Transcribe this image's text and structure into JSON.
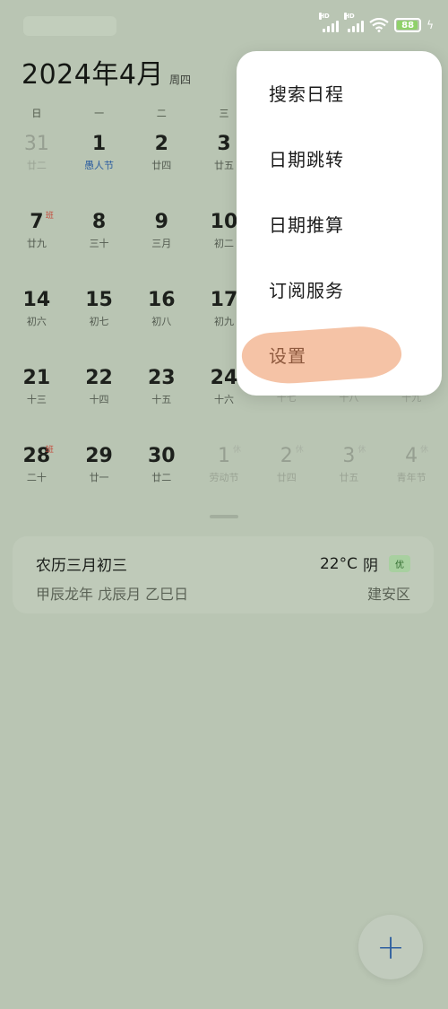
{
  "status": {
    "signal1_hd": "HD",
    "signal2_hd": "HD",
    "battery": "88"
  },
  "header": {
    "title": "2024年4月",
    "weekday": "周四"
  },
  "weekdays": [
    "日",
    "一",
    "二",
    "三",
    "四",
    "五",
    "六"
  ],
  "calendar": [
    {
      "day": "31",
      "lunar": "廿二",
      "faded": true
    },
    {
      "day": "1",
      "lunar": "愚人节",
      "festival": true
    },
    {
      "day": "2",
      "lunar": "廿四"
    },
    {
      "day": "3",
      "lunar": "廿五"
    },
    {
      "day": "",
      "lunar": ""
    },
    {
      "day": "",
      "lunar": ""
    },
    {
      "day": "",
      "lunar": ""
    },
    {
      "day": "7",
      "lunar": "廿九",
      "tag": "班"
    },
    {
      "day": "8",
      "lunar": "三十"
    },
    {
      "day": "9",
      "lunar": "三月"
    },
    {
      "day": "10",
      "lunar": "初二"
    },
    {
      "day": "",
      "lunar": ""
    },
    {
      "day": "",
      "lunar": ""
    },
    {
      "day": "",
      "lunar": ""
    },
    {
      "day": "14",
      "lunar": "初六"
    },
    {
      "day": "15",
      "lunar": "初七"
    },
    {
      "day": "16",
      "lunar": "初八"
    },
    {
      "day": "17",
      "lunar": "初九"
    },
    {
      "day": "",
      "lunar": ""
    },
    {
      "day": "",
      "lunar": ""
    },
    {
      "day": "",
      "lunar": ""
    },
    {
      "day": "21",
      "lunar": "十三"
    },
    {
      "day": "22",
      "lunar": "十四"
    },
    {
      "day": "23",
      "lunar": "十五"
    },
    {
      "day": "24",
      "lunar": "十六"
    },
    {
      "day": "",
      "lunar": "十七",
      "faded": true
    },
    {
      "day": "",
      "lunar": "十八",
      "faded": true
    },
    {
      "day": "",
      "lunar": "十九",
      "faded": true
    },
    {
      "day": "28",
      "lunar": "二十",
      "tag": "班"
    },
    {
      "day": "29",
      "lunar": "廿一"
    },
    {
      "day": "30",
      "lunar": "廿二"
    },
    {
      "day": "1",
      "lunar": "劳动节",
      "faded": true,
      "tag": "休"
    },
    {
      "day": "2",
      "lunar": "廿四",
      "faded": true,
      "tag": "休"
    },
    {
      "day": "3",
      "lunar": "廿五",
      "faded": true,
      "tag": "休"
    },
    {
      "day": "4",
      "lunar": "青年节",
      "faded": true,
      "tag": "休"
    }
  ],
  "info": {
    "lunar_date": "农历三月初三",
    "temperature": "22°C",
    "weather": "阴",
    "aqi": "优",
    "ganzhi": "甲辰龙年 戊辰月 乙巳日",
    "district": "建安区"
  },
  "menu": {
    "items": [
      {
        "label": "搜索日程"
      },
      {
        "label": "日期跳转"
      },
      {
        "label": "日期推算"
      },
      {
        "label": "订阅服务"
      },
      {
        "label": "设置"
      }
    ]
  },
  "fab": {
    "label": "+"
  },
  "colors": {
    "background": "#b9c5b3",
    "accent": "#2e5fa0",
    "workday_tag": "#c44b3c",
    "highlight": "#f5c3a6"
  }
}
